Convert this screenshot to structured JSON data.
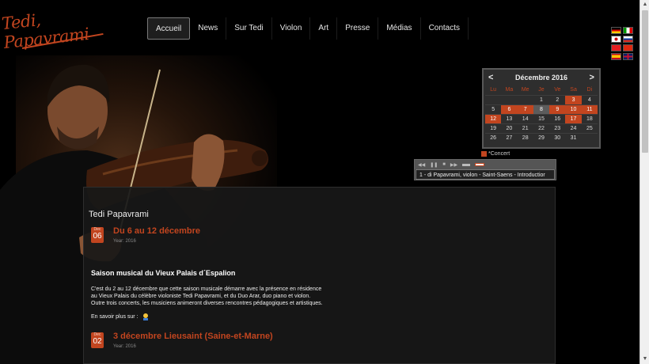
{
  "site": {
    "logo_text": "Tedi, Papavrami"
  },
  "nav": {
    "items": [
      {
        "label": "Accueil",
        "active": true
      },
      {
        "label": "News"
      },
      {
        "label": "Sur Tedi"
      },
      {
        "label": "Violon"
      },
      {
        "label": "Art"
      },
      {
        "label": "Presse"
      },
      {
        "label": "Médias"
      },
      {
        "label": "Contacts"
      }
    ]
  },
  "languages": [
    "de-flag-icon",
    "it-flag-icon",
    "jp-flag-icon",
    "ru-flag-icon",
    "al-flag-icon",
    "cn-flag-icon",
    "es-flag-icon",
    "gb-flag-icon"
  ],
  "calendar": {
    "month": "Décembre 2016",
    "prev": "<",
    "next": ">",
    "weekdays": [
      "Lu",
      "Ma",
      "Me",
      "Je",
      "Ve",
      "Sa",
      "Di"
    ],
    "weeks": [
      [
        "",
        "",
        "",
        "1",
        "2",
        "3",
        "4"
      ],
      [
        "5",
        "6",
        "7",
        "8",
        "9",
        "10",
        "11"
      ],
      [
        "12",
        "13",
        "14",
        "15",
        "16",
        "17",
        "18"
      ],
      [
        "19",
        "20",
        "21",
        "22",
        "23",
        "24",
        "25"
      ],
      [
        "26",
        "27",
        "28",
        "29",
        "30",
        "31",
        ""
      ]
    ],
    "event_days": [
      "3",
      "6",
      "7",
      "9",
      "10",
      "11",
      "12",
      "17"
    ],
    "today": "8",
    "legend": "*Concert"
  },
  "player": {
    "track": "1 - di Papavrami, violon - Saint-Saens - Introductior"
  },
  "content": {
    "title": "Tedi Papavrami",
    "events": [
      {
        "month": "Dec",
        "day": "06",
        "title": "Du 6 au 12 décembre",
        "year": "Year: 2016"
      },
      {
        "month": "Dec",
        "day": "02",
        "title": "3 décembre Lieusaint (Saine-et-Marne)",
        "year": "Year: 2016"
      }
    ],
    "article": {
      "heading": "Saison  musical du Vieux Palais d´Espalion",
      "lines": [
        "C'est du 2 au 12 décembre que cette saison musicale démarre avec la présence en résidence",
        "au Vieux Palais du célèbre violoniste Tedi Papavrami, et du Duo Arar, duo piano et violon.",
        "Outre trois concerts, les musiciens animeront diverses rencontres pédagogiques et artistiques."
      ],
      "more": "En savoir plus sur :"
    }
  },
  "colors": {
    "accent": "#c2451f",
    "background": "#000000"
  }
}
